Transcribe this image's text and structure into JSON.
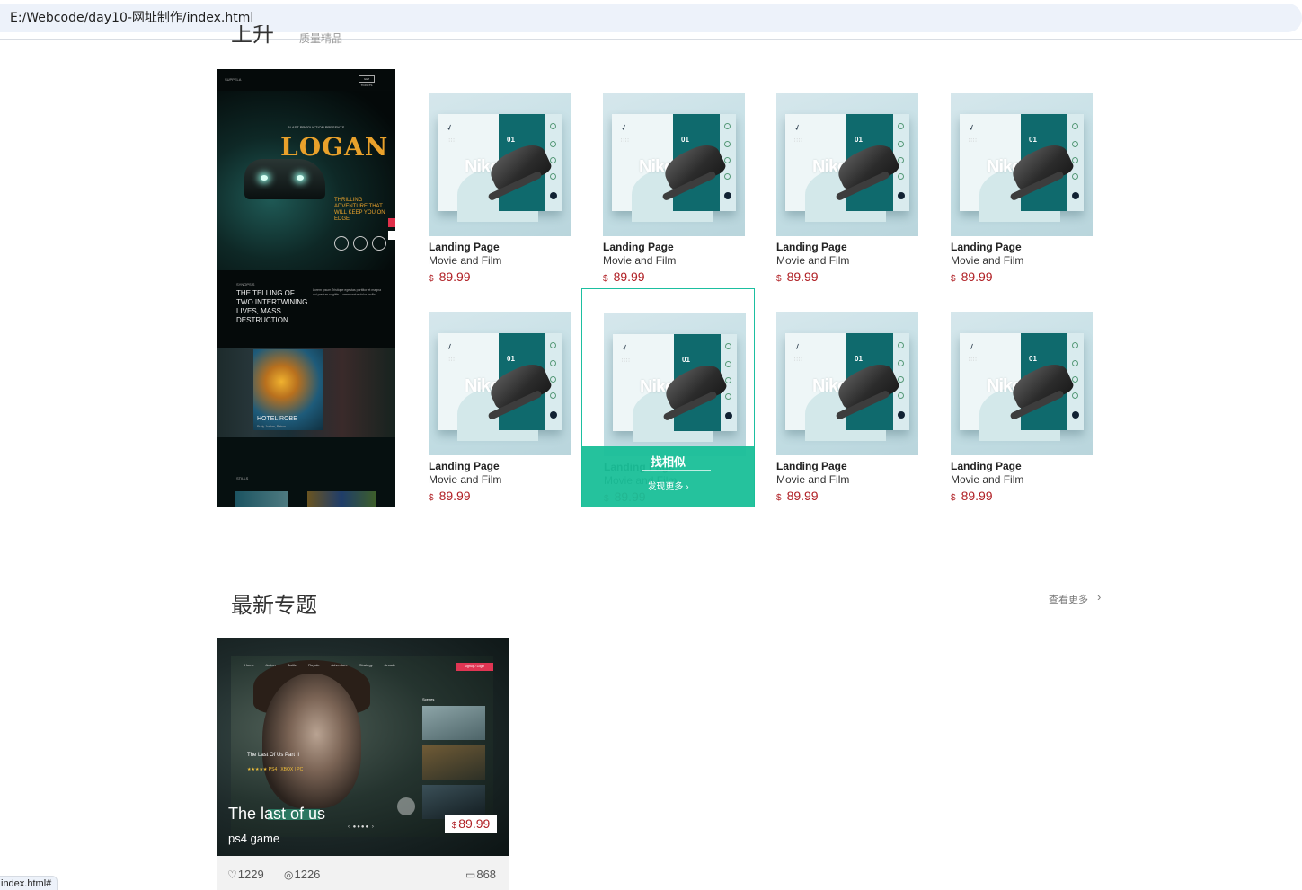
{
  "browser": {
    "address": "E:/Webcode/day10-网址制作/index.html",
    "status_url": "index.html#"
  },
  "section_top": {
    "title": "上升",
    "subtitle": "质量精品"
  },
  "left_banner": {
    "logo": "SUPPELA",
    "button": "GET TICKETS",
    "kicker": "BLAST PRODUCTION PRESENTS",
    "movie_title": "LOGAN",
    "tagline": "THRILLING ADVENTURE THAT WILL KEEP YOU ON EDGE",
    "kicker2": "SYNOPSIS",
    "telling": "THE TELLING OF TWO INTERTWINING LIVES, MASS DESTRUCTION.",
    "body_text": "Lorem ipsum Tristique egestas porttitor et magna dui pretium sagittis. Lorem varius dolor facilisi.",
    "hotel": "HOTEL ROBE",
    "hotel_sub": "Rudy Jordan, Retros",
    "kicker3": "STILLS"
  },
  "products": [
    {
      "name": "Landing Page",
      "category": "Movie and Film",
      "currency": "$",
      "price": "89.99",
      "brand": "Nike",
      "number": "01"
    },
    {
      "name": "Landing Page",
      "category": "Movie and Film",
      "currency": "$",
      "price": "89.99",
      "brand": "Nike",
      "number": "01"
    },
    {
      "name": "Landing Page",
      "category": "Movie and Film",
      "currency": "$",
      "price": "89.99",
      "brand": "Nike",
      "number": "01"
    },
    {
      "name": "Landing Page",
      "category": "Movie and Film",
      "currency": "$",
      "price": "89.99",
      "brand": "Nike",
      "number": "01"
    },
    {
      "name": "Landing Page",
      "category": "Movie and Film",
      "currency": "$",
      "price": "89.99",
      "brand": "Nike",
      "number": "01"
    },
    {
      "name": "Landing Page",
      "category": "Movie and Film",
      "currency": "$",
      "price": "89.99",
      "brand": "Nike",
      "number": "01"
    },
    {
      "name": "Landing Page",
      "category": "Movie and Film",
      "currency": "$",
      "price": "89.99",
      "brand": "Nike",
      "number": "01"
    },
    {
      "name": "Landing Page",
      "category": "Movie and Film",
      "currency": "$",
      "price": "89.99",
      "brand": "Nike",
      "number": "01"
    }
  ],
  "hover_overlay": {
    "find_similar": "找相似",
    "discover_more": "发现更多 ›"
  },
  "section_latest": {
    "title": "最新专题",
    "more": "查看更多",
    "more_arrow": "›"
  },
  "topic": {
    "title": "The last of us",
    "subtitle": "ps4 game",
    "currency": "$",
    "price": "89.99",
    "likes": "1229",
    "views": "1226",
    "comments": "868",
    "nav": "Home Action Battle Royale Adventure Strategy Arcade",
    "signup": "Signup / Login",
    "scenes_label": "Scenes",
    "game_small_title": "The Last Of Us Part II",
    "stars": "★★★★★ PS4 | XBOX | PC",
    "dots": "‹ ●●●● ›"
  },
  "icons": {
    "like": "heart-icon",
    "view": "eye-icon",
    "comment": "comment-icon"
  },
  "colors": {
    "accent_green": "#1bbf98",
    "price_red": "#b01f24",
    "address_bar_bg": "#edf2fa"
  }
}
